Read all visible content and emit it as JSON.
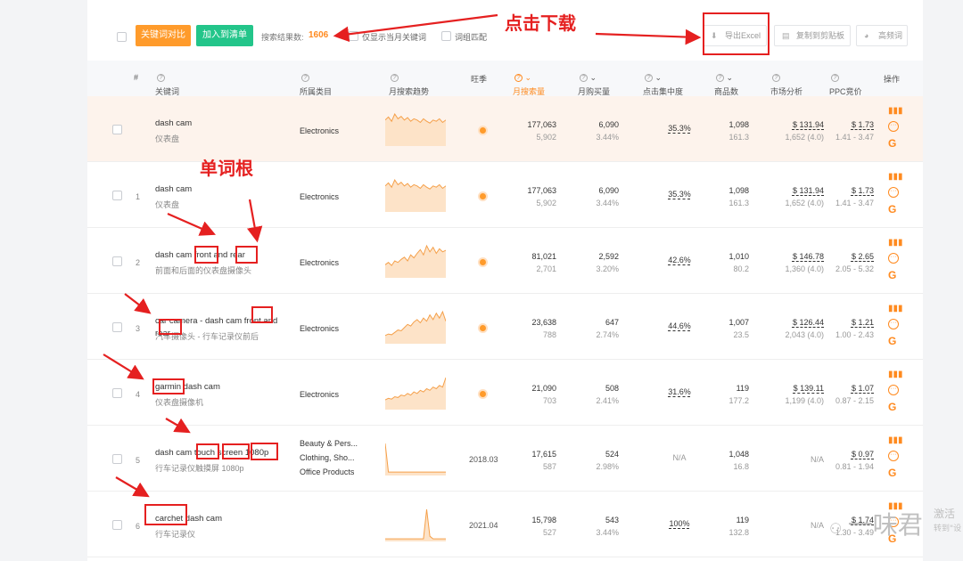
{
  "toolbar": {
    "compare_btn": "关键词对比",
    "add_list_btn": "加入到清单",
    "result_label": "搜索结果数:",
    "result_count": "1606",
    "filter_month": "仅显示当月关键词",
    "filter_phrase": "词组匹配",
    "export_btn": "导出Excel",
    "copy_btn": "复制到剪贴板",
    "freq_btn": "高频词"
  },
  "annotations": {
    "download": "点击下载",
    "root": "单词根"
  },
  "columns": [
    "#",
    "关键词",
    "所属类目",
    "月搜索趋势",
    "旺季",
    "月搜索量",
    "月购买量",
    "点击集中度",
    "商品数",
    "市场分析",
    "PPC竞价",
    "操作"
  ],
  "rows": [
    {
      "num": "",
      "kw": "dash cam",
      "kw_cn": "仪表盘",
      "cat": "Electronics",
      "season": "",
      "vol": "177,063",
      "vol_sub": "5,902",
      "buy": "6,090",
      "buy_sub": "3.44%",
      "conc": "35.3%",
      "prod": "1,098",
      "prod_sub": "161.3",
      "mkt": "$ 131.94",
      "mkt_sub": "1,652 (4.0)",
      "ppc": "$ 1.73",
      "ppc_sub": "1.41 - 3.47",
      "trend": [
        40,
        45,
        38,
        50,
        42,
        46,
        40,
        44,
        38,
        42,
        40,
        36,
        42,
        38,
        35,
        40,
        38,
        42,
        36,
        40
      ]
    },
    {
      "num": "1",
      "kw": "dash cam",
      "kw_cn": "仪表盘",
      "cat": "Electronics",
      "season": "",
      "vol": "177,063",
      "vol_sub": "5,902",
      "buy": "6,090",
      "buy_sub": "3.44%",
      "conc": "35.3%",
      "prod": "1,098",
      "prod_sub": "161.3",
      "mkt": "$ 131.94",
      "mkt_sub": "1,652 (4.0)",
      "ppc": "$ 1.73",
      "ppc_sub": "1.41 - 3.47",
      "trend": [
        40,
        45,
        38,
        50,
        42,
        46,
        40,
        44,
        38,
        42,
        40,
        36,
        42,
        38,
        35,
        40,
        38,
        42,
        36,
        40
      ]
    },
    {
      "num": "2",
      "kw": "dash cam front and rear",
      "kw_cn": "前面和后面的仪表盘摄像头",
      "cat": "Electronics",
      "season": "",
      "vol": "81,021",
      "vol_sub": "2,701",
      "buy": "2,592",
      "buy_sub": "3.20%",
      "conc": "42.6%",
      "prod": "1,010",
      "prod_sub": "80.2",
      "mkt": "$ 146.78",
      "mkt_sub": "1,360 (4.0)",
      "ppc": "$ 2.65",
      "ppc_sub": "2.05 - 5.32",
      "trend": [
        15,
        18,
        14,
        20,
        18,
        22,
        25,
        20,
        28,
        24,
        30,
        35,
        28,
        40,
        32,
        38,
        30,
        36,
        32,
        34
      ]
    },
    {
      "num": "3",
      "kw": "car camera - dash cam front and rear",
      "kw_cn": "汽车摄像头 - 行车记录仪前后",
      "cat": "Electronics",
      "season": "",
      "vol": "23,638",
      "vol_sub": "788",
      "buy": "647",
      "buy_sub": "2.74%",
      "conc": "44.6%",
      "prod": "1,007",
      "prod_sub": "23.5",
      "mkt": "$ 126.44",
      "mkt_sub": "2,043 (4.0)",
      "ppc": "$ 1.21",
      "ppc_sub": "1.00 - 2.43",
      "trend": [
        8,
        10,
        9,
        12,
        15,
        14,
        18,
        22,
        20,
        25,
        28,
        24,
        30,
        26,
        34,
        28,
        36,
        30,
        38,
        26
      ]
    },
    {
      "num": "4",
      "kw": "garmin dash cam",
      "kw_cn": "仪表盘摄像机",
      "cat": "Electronics",
      "season": "",
      "vol": "21,090",
      "vol_sub": "703",
      "buy": "508",
      "buy_sub": "2.41%",
      "conc": "31.6%",
      "prod": "119",
      "prod_sub": "177.2",
      "mkt": "$ 139.11",
      "mkt_sub": "1,199 (4.0)",
      "ppc": "$ 1.07",
      "ppc_sub": "0.87 - 2.15",
      "trend": [
        10,
        12,
        11,
        14,
        13,
        16,
        15,
        18,
        16,
        20,
        18,
        22,
        20,
        24,
        22,
        26,
        24,
        28,
        26,
        38
      ]
    },
    {
      "num": "5",
      "kw": "dash cam touch screen 1080p",
      "kw_cn": "行车记录仪触摸屏 1080p",
      "cat": "Beauty & Pers... Clothing, Sho... Office Products",
      "season": "2018.03",
      "vol": "17,615",
      "vol_sub": "587",
      "buy": "524",
      "buy_sub": "2.98%",
      "conc": "N/A",
      "prod": "1,048",
      "prod_sub": "16.8",
      "mkt": "N/A",
      "mkt_sub": "",
      "ppc": "$ 0.97",
      "ppc_sub": "0.81 - 1.94",
      "trend": [
        36,
        2,
        2,
        2,
        2,
        2,
        2,
        2,
        2,
        2,
        2,
        2,
        2,
        2,
        2,
        2,
        2,
        2,
        2,
        2
      ]
    },
    {
      "num": "6",
      "kw": "carchet dash cam",
      "kw_cn": "行车记录仪",
      "cat": "",
      "season": "2021.04",
      "vol": "15,798",
      "vol_sub": "527",
      "buy": "543",
      "buy_sub": "3.44%",
      "conc": "100%",
      "prod": "119",
      "prod_sub": "132.8",
      "mkt": "N/A",
      "mkt_sub": "",
      "ppc": "$ 1.74",
      "ppc_sub": "1.30 - 3.49",
      "trend": [
        1,
        1,
        1,
        1,
        1,
        1,
        1,
        1,
        1,
        1,
        1,
        1,
        1,
        36,
        4,
        1,
        1,
        1,
        1,
        1
      ]
    }
  ],
  "watermark": {
    "name": "一味君",
    "line1": "激活",
    "line2": "转到\"设"
  },
  "colors": {
    "orange": "#ff9b2b",
    "green": "#23c58a",
    "red": "#e52020"
  }
}
